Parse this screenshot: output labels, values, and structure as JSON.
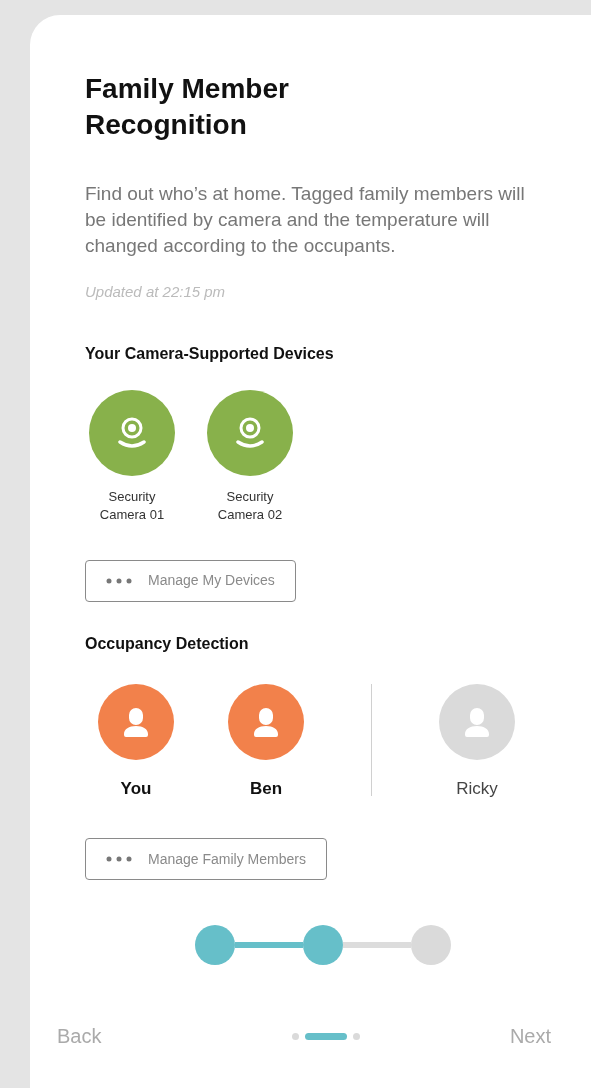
{
  "title": "Family Member Recognition",
  "description": "Find out who’s at home. Tagged family members will be identified by camera and the temperature will changed according to the occupants.",
  "updated": "Updated at 22:15 pm",
  "devices_section": {
    "heading": "Your Camera-Supported Devices",
    "devices": [
      {
        "name": "Security Camera 01"
      },
      {
        "name": "Security Camera 02"
      }
    ],
    "button": "Manage My Devices"
  },
  "occupancy_section": {
    "heading": "Occupancy Detection",
    "members": [
      {
        "name": "You",
        "present": true
      },
      {
        "name": "Ben",
        "present": true
      },
      {
        "name": "Ricky",
        "present": false
      }
    ],
    "button": "Manage Family Members"
  },
  "steps": [
    {
      "done": true
    },
    {
      "done": true
    },
    {
      "done": false
    }
  ],
  "pager": [
    {
      "selected": false
    },
    {
      "selected": true
    },
    {
      "selected": false
    }
  ],
  "back": "Back",
  "next": "Next"
}
